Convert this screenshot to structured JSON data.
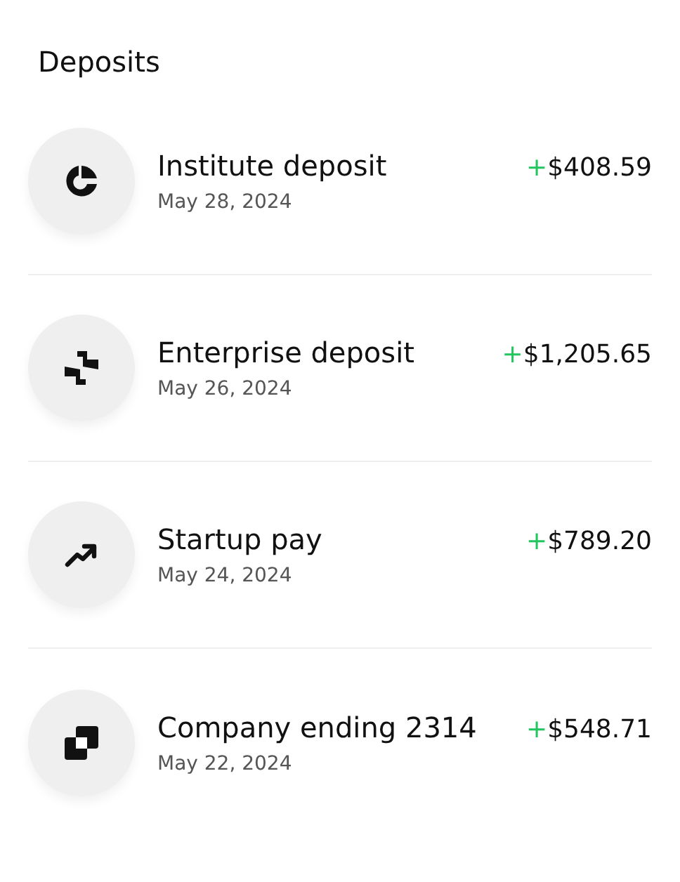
{
  "title": "Deposits",
  "deposits": [
    {
      "name": "Institute deposit",
      "date": "May 28, 2024",
      "sign": "+",
      "amount": "$408.59"
    },
    {
      "name": "Enterprise deposit",
      "date": "May 26, 2024",
      "sign": "+",
      "amount": "$1,205.65"
    },
    {
      "name": "Startup pay",
      "date": "May 24, 2024",
      "sign": "+",
      "amount": "$789.20"
    },
    {
      "name": "Company ending 2314",
      "date": "May 22, 2024",
      "sign": "+",
      "amount": "$548.71"
    }
  ]
}
